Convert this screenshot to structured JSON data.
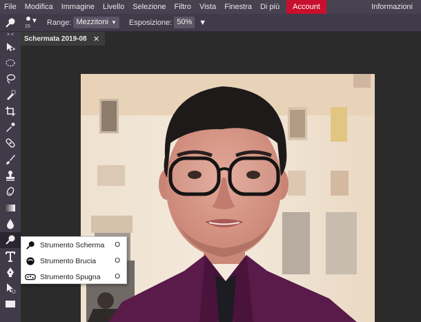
{
  "menu": {
    "items": [
      "File",
      "Modifica",
      "Immagine",
      "Livello",
      "Selezione",
      "Filtro",
      "Vista",
      "Finestra",
      "Di più"
    ],
    "account": "Account",
    "right": "Informazioni"
  },
  "options": {
    "brush_size": "15",
    "range_label": "Range:",
    "range_value": "Mezzitoni",
    "exposure_label": "Esposizione:",
    "exposure_value": "50%"
  },
  "tab": {
    "title": "Schermata 2019-08",
    "close": "✕"
  },
  "flyout": {
    "items": [
      {
        "name": "Strumento Scherma",
        "key": "O"
      },
      {
        "name": "Strumento Brucia",
        "key": "O"
      },
      {
        "name": "Strumento Spugna",
        "key": "O"
      }
    ]
  },
  "toolbar": {
    "collapse": "> <",
    "tools": [
      "move-icon",
      "marquee-icon",
      "lasso-icon",
      "quick-selection-icon",
      "crop-icon",
      "eyedropper-icon",
      "healing-icon",
      "brush-icon",
      "stamp-icon",
      "eraser-icon",
      "gradient-icon",
      "blur-icon",
      "dodge-icon",
      "type-icon",
      "pen-icon",
      "path-selection-icon",
      "rectangle-icon"
    ]
  },
  "colors": {
    "menubar": "#474150",
    "toolbar": "#403a49",
    "account": "#c8102e",
    "canvas_bg": "#2b2b2b"
  }
}
